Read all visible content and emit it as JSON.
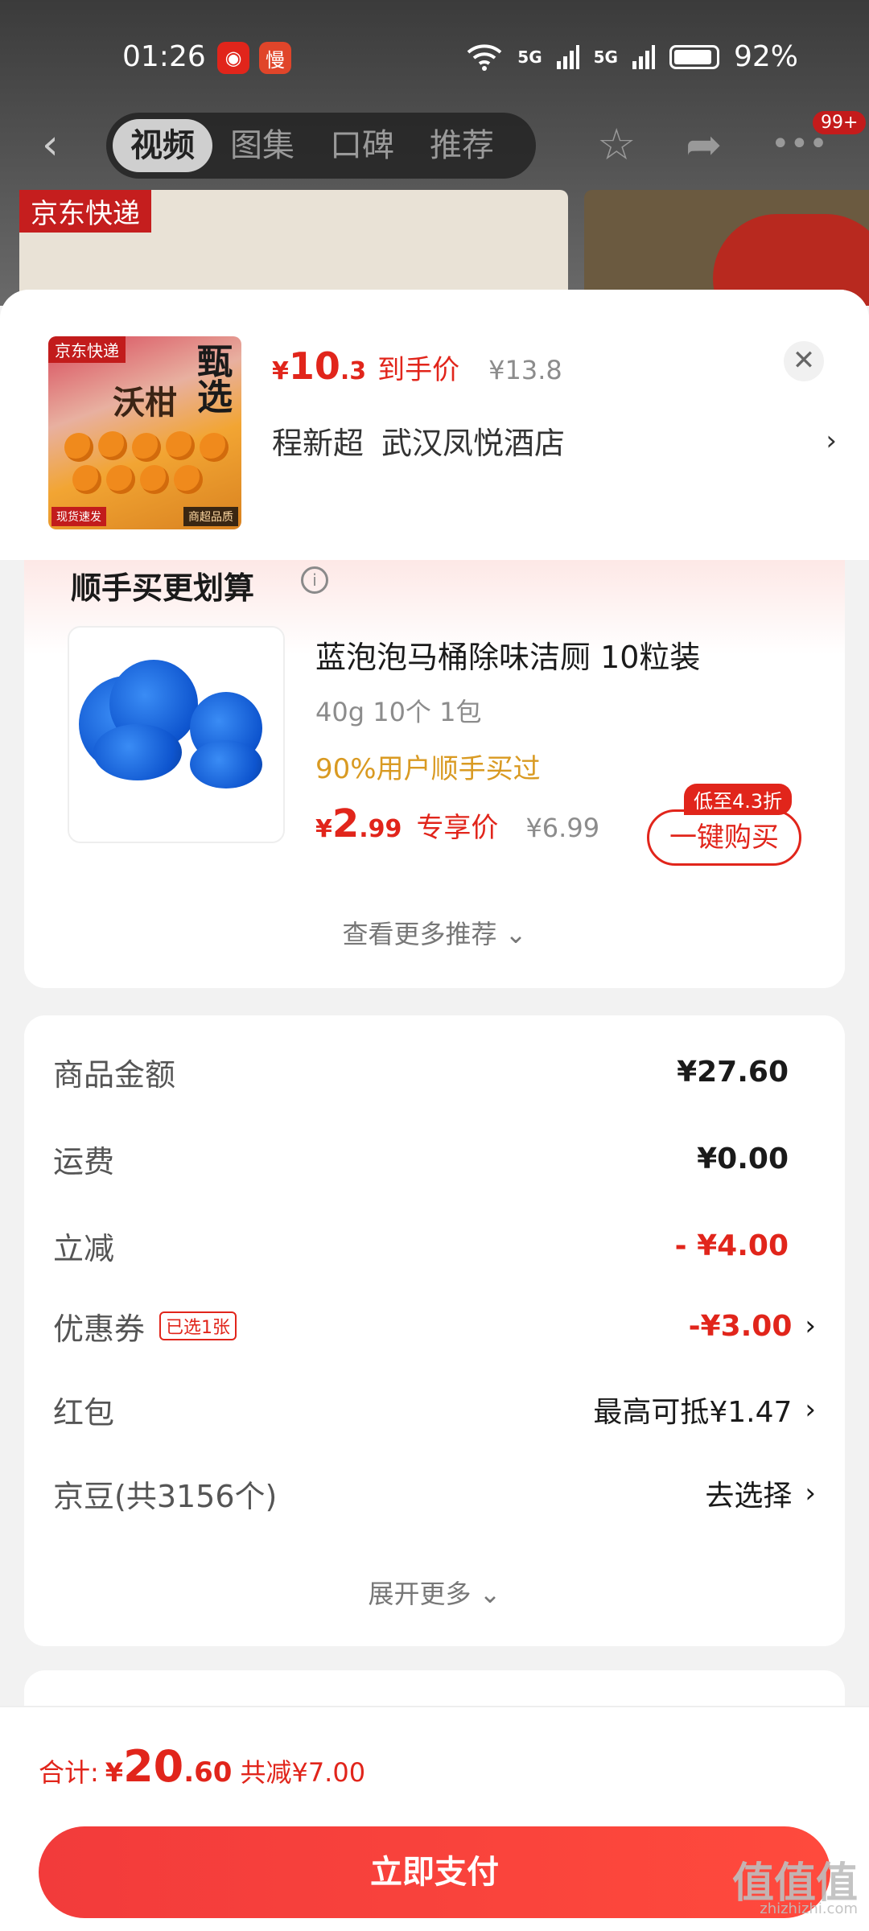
{
  "status_bar": {
    "time": "01:26",
    "app1_icon": "jd-app-icon",
    "app2_label": "慢",
    "sig1": "5G",
    "sig2": "5G",
    "battery": "92%"
  },
  "nav": {
    "tabs": [
      "视频",
      "图集",
      "口碑",
      "推荐"
    ],
    "active_tab": 0,
    "badge": "99+"
  },
  "bg_thumb": {
    "label": "京东快递"
  },
  "product": {
    "image_labels": {
      "express": "京东快递",
      "pick": "甄选",
      "name": "沃柑",
      "badge_left": "现货速发",
      "badge_right": "商超品质"
    },
    "currency": "¥",
    "price_int": "10",
    "price_dec": ".3",
    "price_label": "到手价",
    "orig_price": "¥13.8",
    "receiver_name": "程新超",
    "receiver_addr": "武汉凤悦酒店"
  },
  "upsell": {
    "title": "顺手买更划算",
    "item_title": "蓝泡泡马桶除味洁厕 10粒装",
    "item_spec": "40g 10个 1包",
    "item_rate": "90%用户顺手买过",
    "price_int": "2",
    "price_dec": ".99",
    "price_label": "专享价",
    "orig_price": "¥6.99",
    "buy_label": "一键购买",
    "buy_badge": "低至4.3折",
    "more": "查看更多推荐 ⌄"
  },
  "fees": [
    {
      "label": "商品金额",
      "value": "¥27.60"
    },
    {
      "label": "运费",
      "value": "¥0.00"
    },
    {
      "label": "立减",
      "value": "- ¥4.00"
    },
    {
      "label": "优惠券",
      "tag": "已选1张",
      "value": "-¥3.00"
    },
    {
      "label": "红包",
      "value": "最高可抵¥1.47"
    },
    {
      "label": "京豆(共3156个)",
      "value": "去选择"
    }
  ],
  "expand_label": "展开更多 ⌄",
  "footer": {
    "total_label": "合计:",
    "currency": "¥",
    "total_int": "20",
    "total_dec": ".60",
    "discount": "共减¥7.00",
    "pay_label": "立即支付",
    "watermark": "值值值",
    "watermark_sub": "zhizhizhi.com"
  },
  "colors": {
    "accent": "#e1251b",
    "rate": "#d99a22",
    "pay_button": "#f23b3b"
  }
}
